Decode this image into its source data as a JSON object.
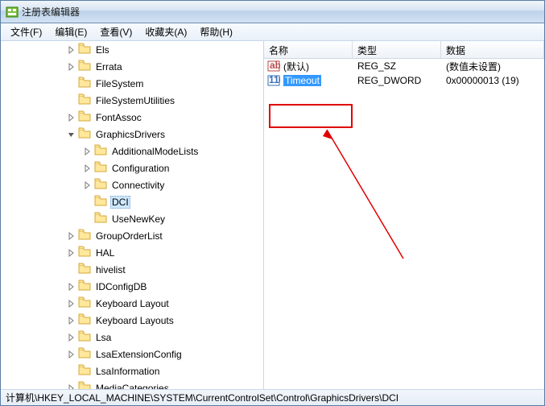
{
  "window": {
    "title": "注册表编辑器"
  },
  "menu": {
    "file": "文件(F)",
    "edit": "编辑(E)",
    "view": "查看(V)",
    "favorites": "收藏夹(A)",
    "help": "帮助(H)"
  },
  "tree": {
    "items": [
      {
        "indent": 4,
        "exp": "r",
        "label": "Els"
      },
      {
        "indent": 4,
        "exp": "r",
        "label": "Errata"
      },
      {
        "indent": 4,
        "exp": "n",
        "label": "FileSystem"
      },
      {
        "indent": 4,
        "exp": "n",
        "label": "FileSystemUtilities"
      },
      {
        "indent": 4,
        "exp": "r",
        "label": "FontAssoc"
      },
      {
        "indent": 4,
        "exp": "d",
        "label": "GraphicsDrivers"
      },
      {
        "indent": 5,
        "exp": "r",
        "label": "AdditionalModeLists"
      },
      {
        "indent": 5,
        "exp": "r",
        "label": "Configuration"
      },
      {
        "indent": 5,
        "exp": "r",
        "label": "Connectivity"
      },
      {
        "indent": 5,
        "exp": "n",
        "label": "DCI",
        "sel": true
      },
      {
        "indent": 5,
        "exp": "n",
        "label": "UseNewKey"
      },
      {
        "indent": 4,
        "exp": "r",
        "label": "GroupOrderList"
      },
      {
        "indent": 4,
        "exp": "r",
        "label": "HAL"
      },
      {
        "indent": 4,
        "exp": "n",
        "label": "hivelist"
      },
      {
        "indent": 4,
        "exp": "r",
        "label": "IDConfigDB"
      },
      {
        "indent": 4,
        "exp": "r",
        "label": "Keyboard Layout"
      },
      {
        "indent": 4,
        "exp": "r",
        "label": "Keyboard Layouts"
      },
      {
        "indent": 4,
        "exp": "r",
        "label": "Lsa"
      },
      {
        "indent": 4,
        "exp": "r",
        "label": "LsaExtensionConfig"
      },
      {
        "indent": 4,
        "exp": "n",
        "label": "LsaInformation"
      },
      {
        "indent": 4,
        "exp": "r",
        "label": "MediaCategories"
      }
    ]
  },
  "listview": {
    "columns": {
      "name": "名称",
      "type": "类型",
      "data": "数据"
    },
    "rows": [
      {
        "icon": "ab",
        "name": "(默认)",
        "type": "REG_SZ",
        "data": "(数值未设置)"
      },
      {
        "icon": "110",
        "name": "Timeout",
        "type": "REG_DWORD",
        "data": "0x00000013 (19)",
        "sel": true
      }
    ]
  },
  "statusbar": {
    "path": "计算机\\HKEY_LOCAL_MACHINE\\SYSTEM\\CurrentControlSet\\Control\\GraphicsDrivers\\DCI"
  }
}
